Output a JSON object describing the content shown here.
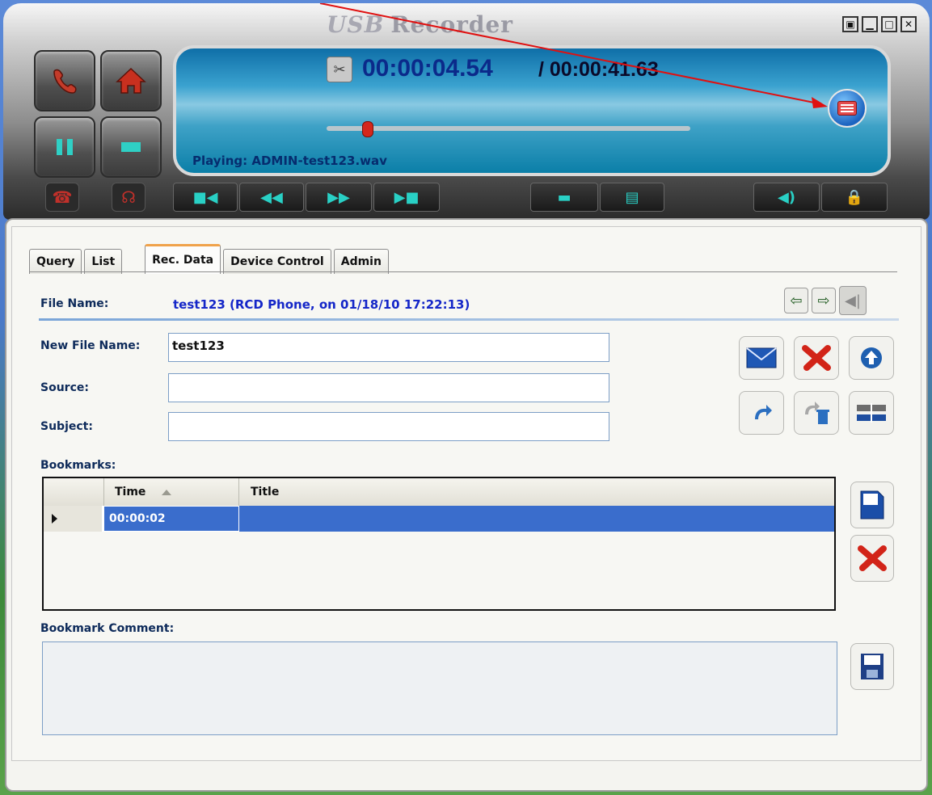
{
  "app": {
    "logo_text": "USB",
    "logo_suffix": "Recorder"
  },
  "window_buttons": [
    "▣",
    "▁",
    "□",
    "✕"
  ],
  "player": {
    "current_time": "00:00:04.54",
    "total_time": "/ 00:00:41.63",
    "playing_status": "Playing: ADMIN-test123.wav",
    "progress_fraction": 0.11
  },
  "controls": {
    "rewind_start": "■◀",
    "rewind": "◀◀",
    "fast_forward": "▶▶",
    "forward_end": "▶■",
    "open": "▬",
    "copy": "▤",
    "volume": "◀)",
    "lock": "🔒"
  },
  "tabs": [
    {
      "label": "Query"
    },
    {
      "label": "List"
    },
    {
      "label": "Rec. Data"
    },
    {
      "label": "Device Control"
    },
    {
      "label": "Admin"
    }
  ],
  "rec_data": {
    "file_name_label": "File Name:",
    "file_name_value": "test123 (RCD Phone, on 01/18/10 17:22:13)",
    "new_file_name_label": "New File Name:",
    "new_file_name_value": "test123",
    "source_label": "Source:",
    "source_value": "",
    "subject_label": "Subject:",
    "subject_value": "",
    "bookmarks_label": "Bookmarks:",
    "bookmark_comment_label": "Bookmark Comment:",
    "bookmark_comment_value": ""
  },
  "bookmarks_table": {
    "headers": [
      "Time",
      "Title"
    ],
    "rows": [
      {
        "time": "00:00:02",
        "title": ""
      }
    ]
  },
  "colors": {
    "accent_blue": "#1426c8",
    "selection": "#3a6dcc",
    "tab_highlight": "#f0a24a"
  }
}
